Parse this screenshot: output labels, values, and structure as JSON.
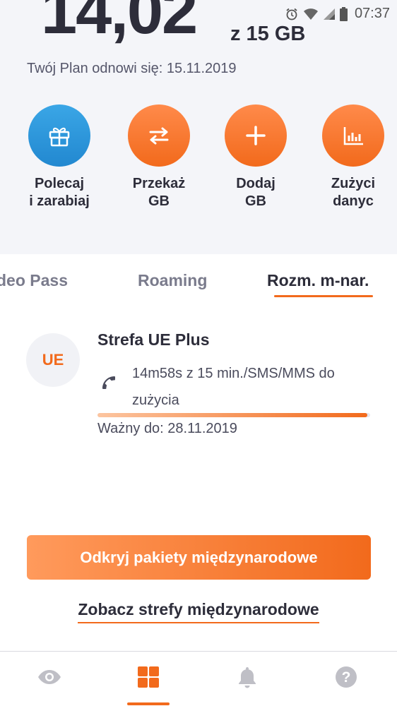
{
  "status_bar": {
    "time": "07:37",
    "icons": [
      "alarm-icon",
      "wifi-icon",
      "signal-icon",
      "battery-icon"
    ]
  },
  "data_usage": {
    "amount": "14,02",
    "of_total": "z 15 GB",
    "renewal": "Twój Plan odnowi się: 15.11.2019"
  },
  "quick_actions": [
    {
      "label": "Polecaj\ni zarabiaj",
      "icon": "gift-icon",
      "color": "#2a95dc"
    },
    {
      "label": "Przekaż\nGB",
      "icon": "transfer-icon",
      "color": "#f26a1c"
    },
    {
      "label": "Dodaj\nGB",
      "icon": "plus-icon",
      "color": "#f26a1c"
    },
    {
      "label": "Zużyci\ndanyc",
      "icon": "bar-chart-icon",
      "color": "#f26a1c"
    }
  ],
  "tabs": [
    {
      "label": "deo Pass",
      "active": false
    },
    {
      "label": "Roaming",
      "active": false
    },
    {
      "label": "Rozm. m-nar.",
      "active": true
    }
  ],
  "zone_card": {
    "badge": "UE",
    "title": "Strefa UE Plus",
    "usage": "14m58s z 15 min./SMS/MMS do zużycia",
    "progress_fraction": 0.99,
    "valid_until": "Ważny do: 28.11.2019"
  },
  "cta_button": "Odkryj pakiety międzynarodowe",
  "link": "Zobacz strefy międzynarodowe",
  "bottom_nav": [
    {
      "icon": "eye-icon",
      "active": false
    },
    {
      "icon": "grid-icon",
      "active": true
    },
    {
      "icon": "bell-icon",
      "active": false
    },
    {
      "icon": "help-icon",
      "active": false
    }
  ],
  "colors": {
    "accent": "#f26a1c",
    "blue": "#2a95dc",
    "text": "#2d2d3a",
    "background": "#f4f5f9"
  }
}
